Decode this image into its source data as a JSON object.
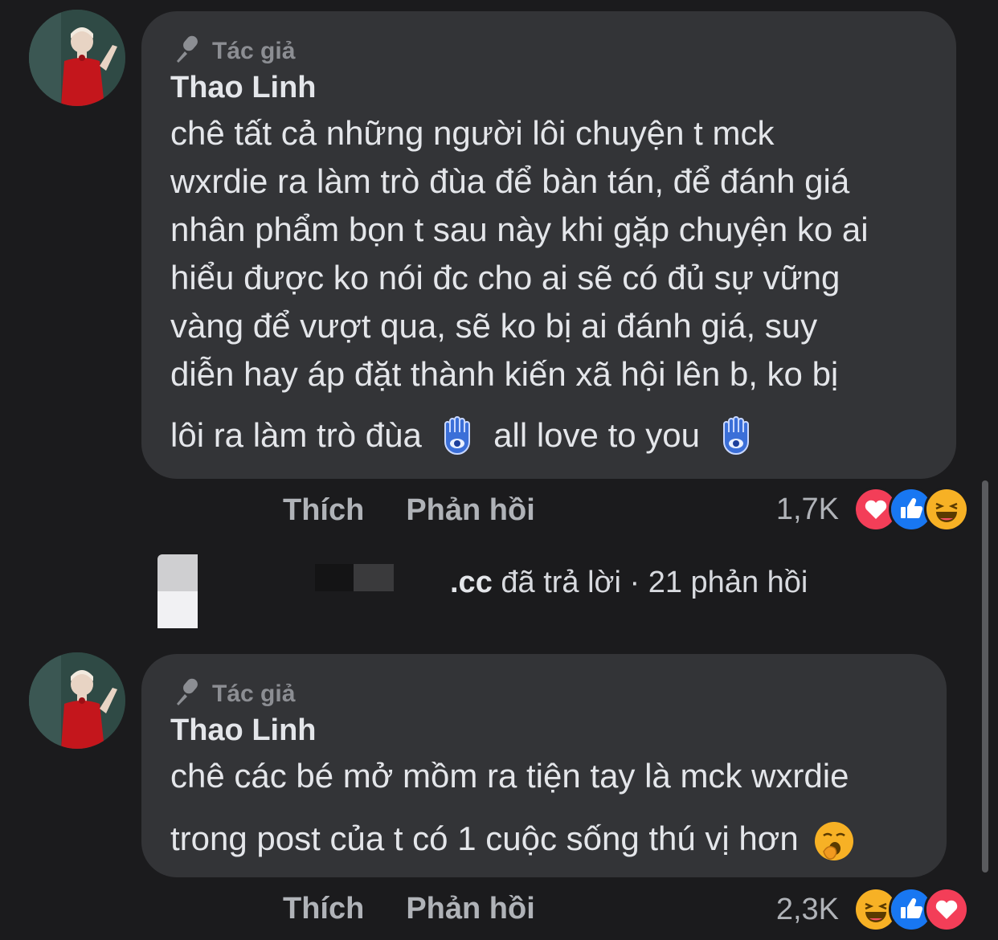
{
  "comments": [
    {
      "badge": "Tác giả",
      "author": "Thao Linh",
      "lines": [
        "chê tất cả những người lôi chuyện t mck",
        "wxrdie ra làm trò đùa để bàn tán, để đánh giá",
        "nhân phẩm bọn t sau này khi gặp chuyện ko ai",
        "hiểu được ko nói đc cho ai sẽ có đủ sự vững",
        "vàng để vượt qua, sẽ ko bị ai đánh giá, suy",
        "diễn hay áp đặt thành kiến xã hội lên b, ko bị"
      ],
      "last_line_a": "lôi ra làm trò đùa",
      "last_line_b": "all love to you",
      "emoji": "hamsa-icon",
      "like_label": "Thích",
      "reply_label": "Phản hồi",
      "reaction_count": "1,7K",
      "reactions": [
        "love-icon",
        "like-icon",
        "haha-icon"
      ]
    },
    {
      "badge": "Tác giả",
      "author": "Thao Linh",
      "lines": [
        "chê các bé mở mồm ra tiện tay là mck wxrdie"
      ],
      "last_line_a": "trong post của t có 1 cuộc sống thú vị hơn",
      "emoji": "yawning-face-icon",
      "like_label": "Thích",
      "reply_label": "Phản hồi",
      "reaction_count": "2,3K",
      "reactions": [
        "haha-icon",
        "like-icon",
        "love-icon"
      ]
    }
  ],
  "reply_summary": {
    "name_fragment": ".cc",
    "action": "đã trả lời",
    "separator": "·",
    "count": "21 phản hồi"
  },
  "colors": {
    "background": "#1b1b1d",
    "bubble": "#333437",
    "secondary_text": "#b0b3b8",
    "like_blue": "#1877f2",
    "love_red": "#f33e58",
    "haha_yellow": "#f7b125"
  }
}
